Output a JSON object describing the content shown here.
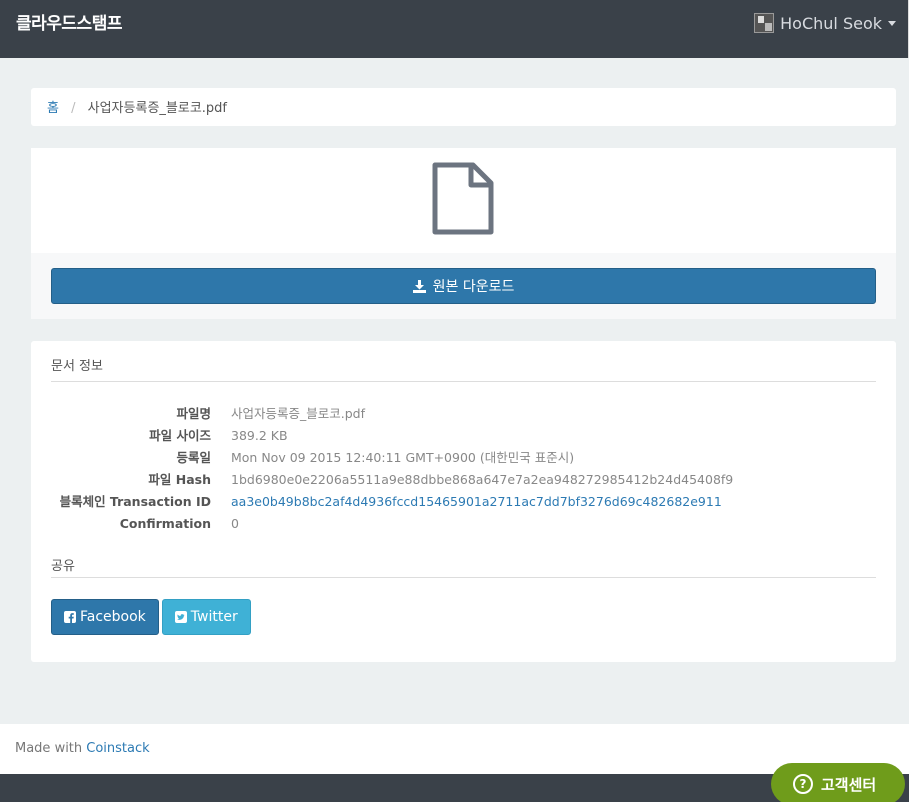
{
  "navbar": {
    "brand": "클라우드스탬프",
    "user_name": "HoChul Seok"
  },
  "breadcrumb": {
    "home": "홈",
    "current": "사업자등록증_블로코.pdf"
  },
  "preview": {
    "icon": "file-icon",
    "download_label": "원본 다운로드"
  },
  "document_info": {
    "title": "문서 정보",
    "fields": [
      {
        "label": "파일명",
        "value": "사업자등록증_블로코.pdf"
      },
      {
        "label": "파일 사이즈",
        "value": "389.2 KB"
      },
      {
        "label": "등록일",
        "value": "Mon Nov 09 2015 12:40:11 GMT+0900 (대한민국 표준시)"
      },
      {
        "label": "파일 Hash",
        "value": "1bd6980e0e2206a5511a9e88dbbe868a647e7a2ea948272985412b24d45408f9"
      },
      {
        "label": "블록체인 Transaction ID",
        "value": "aa3e0b49b8bc2af4d4936fccd15465901a2711ac7dd7bf3276d69c482682e911"
      },
      {
        "label": "Confirmation",
        "value": "0"
      }
    ]
  },
  "share": {
    "title": "공유",
    "facebook_label": "Facebook",
    "twitter_label": "Twitter"
  },
  "footer": {
    "made_with": "Made with ",
    "link": "Coinstack"
  },
  "help": {
    "label": "고객센터"
  },
  "colors": {
    "navbar": "#3a4149",
    "primary": "#2e77aa",
    "info": "#3fb1d6",
    "help": "#6f9c1b"
  }
}
